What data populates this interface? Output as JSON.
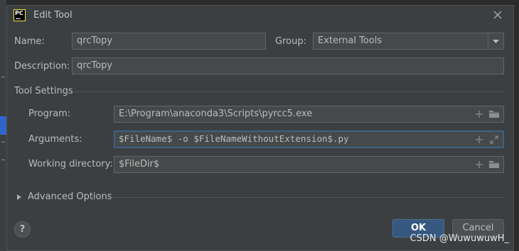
{
  "dialog": {
    "title": "Edit Tool",
    "app_icon_text": "PC",
    "close_icon": "close-icon"
  },
  "form": {
    "name_label": "Name:",
    "name_value": "qrcTopy",
    "group_label": "Group:",
    "group_value": "External Tools",
    "description_label": "Description:",
    "description_value": "qrcTopy"
  },
  "tool_settings": {
    "title": "Tool Settings",
    "program_label": "Program:",
    "program_value": "E:\\Program\\anaconda3\\Scripts\\pyrcc5.exe",
    "arguments_label": "Arguments:",
    "arguments_value": "$FileName$ -o $FileNameWithoutExtension$.py",
    "workdir_label": "Working directory:",
    "workdir_value": "$FileDir$"
  },
  "advanced": {
    "label": "Advanced Options"
  },
  "footer": {
    "help_label": "?",
    "ok_label": "OK",
    "cancel_label": "Cancel"
  },
  "watermark": "CSDN @WuwuwuwH_",
  "colors": {
    "accent": "#365880",
    "focus_border": "#3d6185",
    "app_icon_border": "#f4e84a"
  }
}
